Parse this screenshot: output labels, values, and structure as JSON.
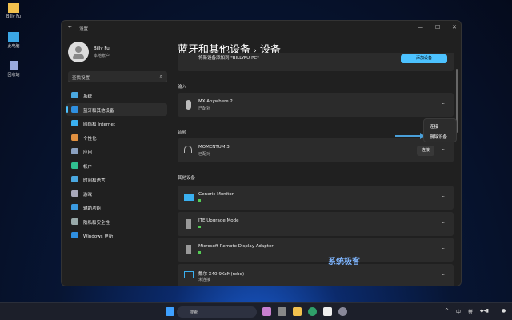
{
  "desktop": {
    "icons": [
      {
        "label": "Billy Fu",
        "icon": "folder-icon",
        "color": "#f2c14e"
      },
      {
        "label": "此电脑",
        "icon": "computer-icon",
        "color": "#3ba7e6"
      },
      {
        "label": "回收站",
        "icon": "recycle-bin-icon",
        "color": "#9ad"
      }
    ]
  },
  "window": {
    "title": "设置",
    "back": "←",
    "controls": [
      "—",
      "☐",
      "✕"
    ]
  },
  "user": {
    "name": "Billy Fu",
    "sub": "本地帐户"
  },
  "search": {
    "placeholder": "查找设置",
    "icon": "⌕"
  },
  "sidebar": {
    "items": [
      {
        "label": "系统",
        "icon": "system-icon",
        "color": "#4aa8e0"
      },
      {
        "label": "蓝牙和其他设备",
        "icon": "bluetooth-icon",
        "color": "#2f8fe0",
        "selected": true
      },
      {
        "label": "网络和 Internet",
        "icon": "wifi-icon",
        "color": "#3ab0f0"
      },
      {
        "label": "个性化",
        "icon": "brush-icon",
        "color": "#e09040"
      },
      {
        "label": "应用",
        "icon": "apps-icon",
        "color": "#8aa0c0"
      },
      {
        "label": "帐户",
        "icon": "account-icon",
        "color": "#30c090"
      },
      {
        "label": "时间和语言",
        "icon": "globe-icon",
        "color": "#4aa8e0"
      },
      {
        "label": "游戏",
        "icon": "gamepad-icon",
        "color": "#aab"
      },
      {
        "label": "辅助功能",
        "icon": "accessibility-icon",
        "color": "#3a9ae0"
      },
      {
        "label": "隐私和安全性",
        "icon": "shield-icon",
        "color": "#9aa"
      },
      {
        "label": "Windows 更新",
        "icon": "update-icon",
        "color": "#2f8fe0"
      }
    ]
  },
  "header": {
    "title": "蓝牙和其他设备",
    "sep": "›",
    "current": "设备"
  },
  "add_device": {
    "text": "将新设备添加到 \"BILLYFU-PC\"",
    "button": "添加设备"
  },
  "sections": {
    "input": "输入",
    "audio": "音频",
    "other": "其他设备"
  },
  "input_devices": [
    {
      "name": "MX Anywhere 2",
      "status": "已配对",
      "icon": "mouse-icon"
    }
  ],
  "audio_devices": [
    {
      "name": "MOMENTUM 3",
      "status": "已配对",
      "icon": "headphones-icon",
      "button": "连接"
    }
  ],
  "other_devices": [
    {
      "name": "Generic Monitor",
      "status_dot": true,
      "icon": "monitor-icon"
    },
    {
      "name": "ITE Upgrade Mode",
      "status_dot": true,
      "icon": "device-icon"
    },
    {
      "name": "Microsoft Remote Display Adapter",
      "status_dot": true,
      "icon": "device-icon"
    },
    {
      "name": "戴尔 X40-9KeM(rebo)",
      "status": "未连接",
      "icon": "display-icon"
    }
  ],
  "more": "···",
  "context_menu": {
    "items": [
      "连接",
      "删除设备"
    ]
  },
  "watermark": "系统极客",
  "taskbar": {
    "search_placeholder": "搜索",
    "tray": [
      "^",
      "中",
      "拼"
    ]
  },
  "accent": "#4cc2ff"
}
